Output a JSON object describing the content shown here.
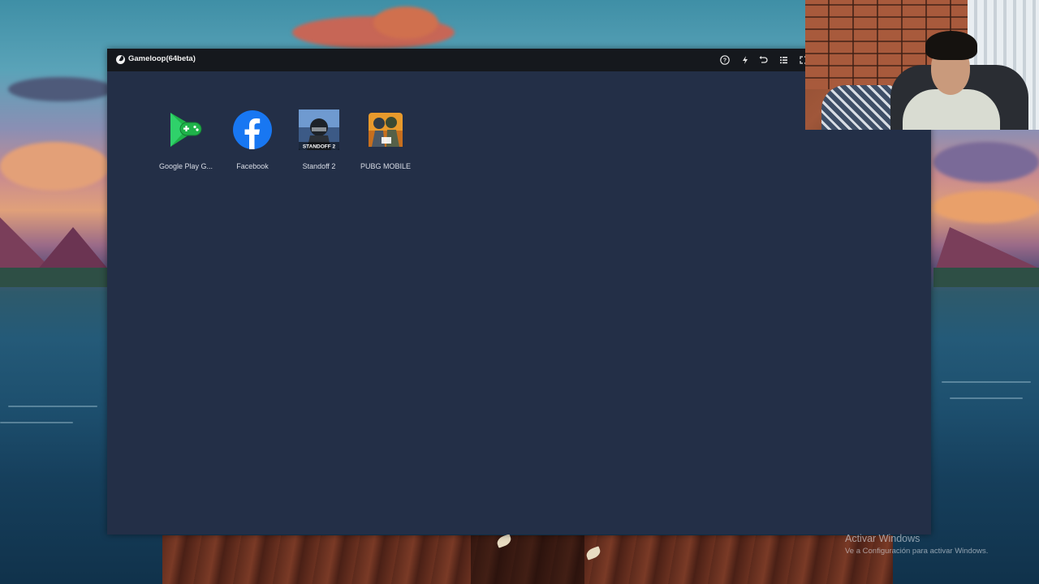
{
  "window": {
    "title": "Gameloop(64beta)",
    "background_color": "#232f47",
    "titlebar_color": "#15181d",
    "toolbar_icons": [
      "help-icon",
      "lightning-icon",
      "undo-icon",
      "menu-icon",
      "fullscreen-icon"
    ]
  },
  "apps": [
    {
      "label": "Google Play G...",
      "icon": "google-play-games-icon"
    },
    {
      "label": "Facebook",
      "icon": "facebook-icon"
    },
    {
      "label": "Standoff 2",
      "icon": "standoff-2-icon",
      "icon_text": "STANDOFF 2"
    },
    {
      "label": "PUBG MOBILE",
      "icon": "pubg-mobile-icon"
    }
  ],
  "activation_watermark": {
    "title": "Activar Windows",
    "subtitle": "Ve a Configuración para activar Windows."
  },
  "colors": {
    "facebook_blue": "#1877f2",
    "play_green": "#1fb34a"
  }
}
